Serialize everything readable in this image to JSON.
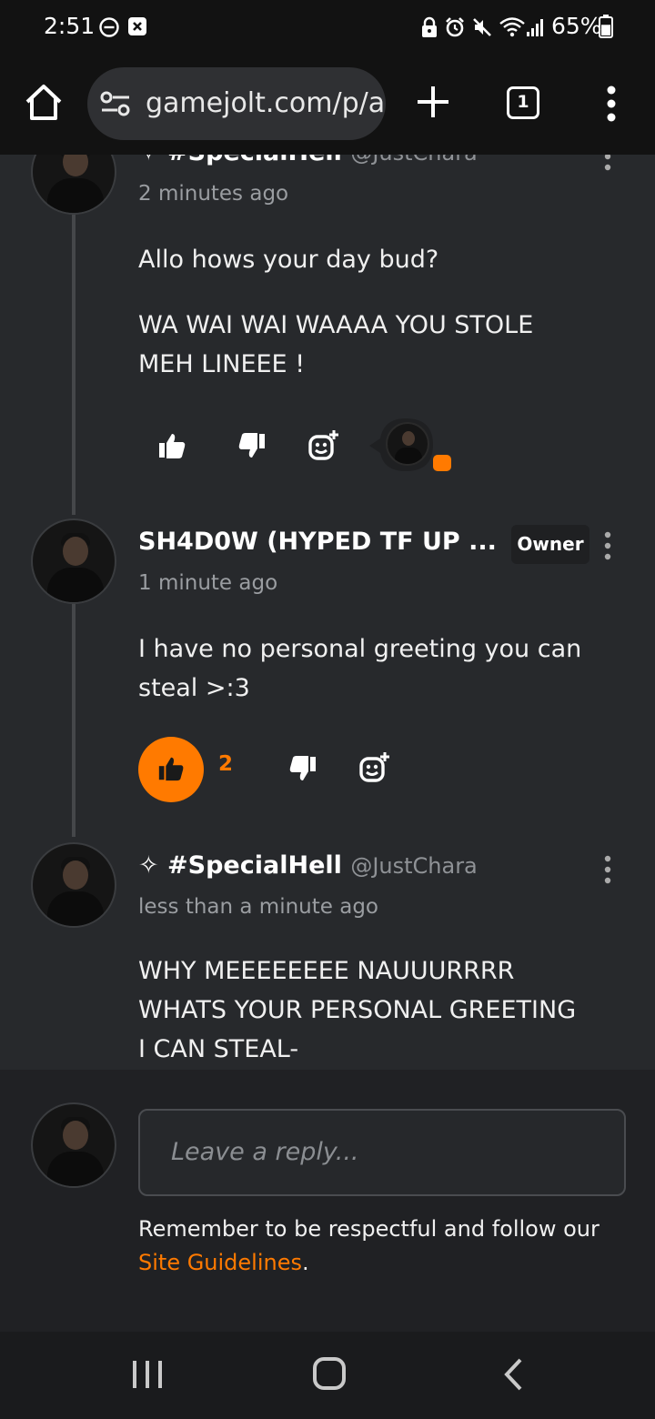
{
  "status_bar": {
    "time": "2:51",
    "battery_percent": "65%",
    "battery_level": 0.65,
    "icons": [
      "do-not-disturb-icon",
      "notification-app-icon",
      "lock-icon",
      "alarm-icon",
      "mute-icon",
      "wifi-icon",
      "signal-icon",
      "battery-icon"
    ]
  },
  "browser": {
    "url": "gamejolt.com/p/a",
    "tab_count": "1",
    "icons": [
      "home-icon",
      "site-settings-icon",
      "new-tab-icon",
      "tab-switcher-icon",
      "menu-icon"
    ]
  },
  "comments": [
    {
      "author": "#SpecialHell",
      "handle": "@JustChara",
      "timestamp": "2 minutes ago",
      "paragraphs": [
        "Allo hows your day bud?",
        "WA WAI WAI WAAAA YOU STOLE",
        "MEH LINEEE !"
      ],
      "like_count": ""
    },
    {
      "author": "SH4D0W (HYPED TF UP ...",
      "badge": "Owner",
      "timestamp": "1 minute ago",
      "paragraphs": [
        "I have no personal greeting you can",
        "steal >:3"
      ],
      "like_count": "2",
      "liked": true
    },
    {
      "author": "#SpecialHell",
      "handle": "@JustChara",
      "timestamp": "less than a minute ago",
      "paragraphs": [
        "WHY MEEEEEEEE NAUUURRRR",
        "WHATS YOUR PERSONAL GREETING",
        "I CAN STEAL-"
      ]
    }
  ],
  "reply_panel": {
    "placeholder": "Leave a reply...",
    "reminder_text": "Remember to be respectful and follow our",
    "guidelines_link": "Site Guidelines",
    "period": "."
  },
  "colors": {
    "accent": "#ff7a00",
    "background": "#27292c",
    "bar_background": "#121212"
  }
}
